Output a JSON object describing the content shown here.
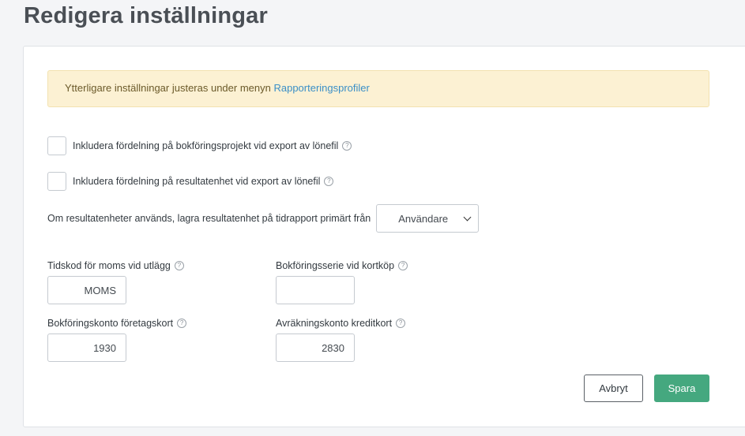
{
  "page": {
    "title": "Redigera inställningar"
  },
  "notice": {
    "text": "Ytterligare inställningar justeras under menyn ",
    "link": "Rapporteringsprofiler"
  },
  "checkboxes": [
    {
      "label": "Inkludera fördelning på bokföringsprojekt vid export av lönefil",
      "checked": false
    },
    {
      "label": "Inkludera fördelning på resultatenhet vid export av lönefil",
      "checked": false
    }
  ],
  "unit_source": {
    "label": "Om resultatenheter används, lagra resultatenhet på tidrapport primärt från",
    "selected": "Användare"
  },
  "fields": {
    "vat_timecode": {
      "label": "Tidskod för moms vid utlägg",
      "value": "MOMS"
    },
    "card_series": {
      "label": "Bokföringsserie vid kortköp",
      "value": ""
    },
    "company_card_account": {
      "label": "Bokföringskonto företagskort",
      "value": "1930"
    },
    "credit_card_account": {
      "label": "Avräkningskonto kreditkort",
      "value": "2830"
    }
  },
  "help_icon_glyph": "?",
  "buttons": {
    "cancel": "Avbryt",
    "save": "Spara"
  },
  "colors": {
    "accent": "#45a87f",
    "link": "#3a8fc7",
    "notice_bg": "#fcf1d3"
  }
}
